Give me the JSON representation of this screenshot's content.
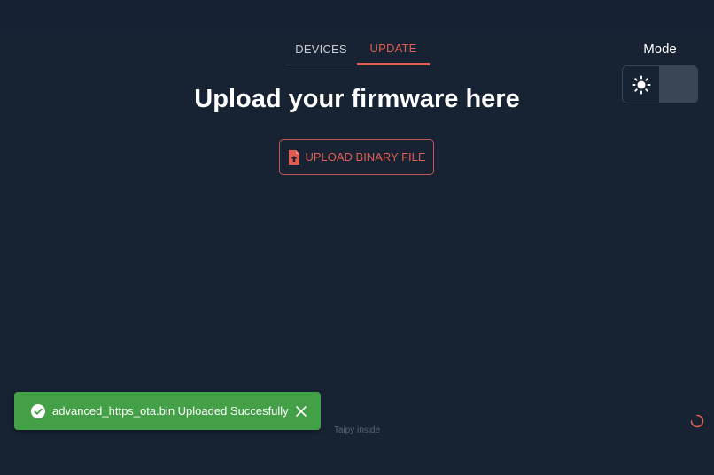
{
  "tabs": [
    {
      "label": "DEVICES",
      "active": false
    },
    {
      "label": "UPDATE",
      "active": true
    }
  ],
  "main": {
    "title": "Upload your firmware here",
    "upload_button_label": "UPLOAD BINARY FILE"
  },
  "mode": {
    "label": "Mode",
    "options": [
      {
        "icon": "sun-icon",
        "value": "light",
        "selected": false
      },
      {
        "icon": "moon-icon",
        "value": "dark",
        "selected": true
      }
    ]
  },
  "notification": {
    "message": "advanced_https_ota.bin Uploaded Succesfully",
    "status": "success",
    "icon": "check-circle-icon",
    "close_icon": "close-icon"
  },
  "footer": {
    "text": "Taipy inside"
  },
  "colors": {
    "background": "#172233",
    "accent": "#e05d53",
    "success": "#43a047",
    "toggle_selected": "#3a4556"
  },
  "icons": {
    "upload": "file-upload-icon",
    "loading": "spinner-icon"
  }
}
